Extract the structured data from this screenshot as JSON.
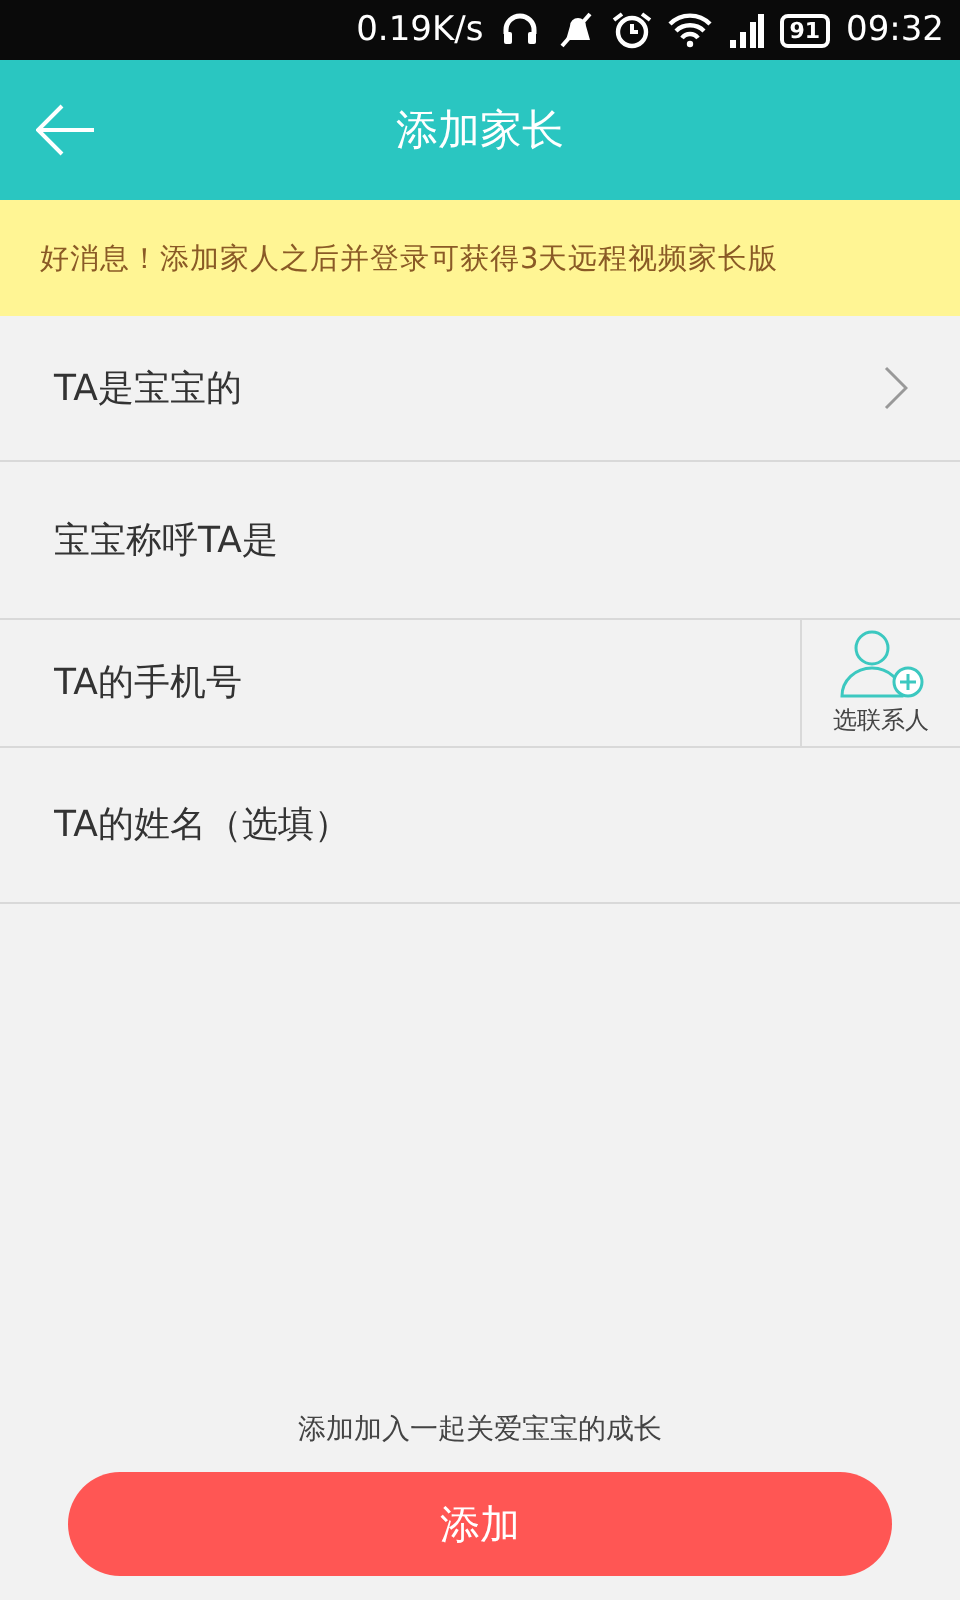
{
  "status_bar": {
    "speed": "0.19K/s",
    "battery": "91",
    "time": "09:32"
  },
  "header": {
    "title": "添加家长"
  },
  "notice": "好消息！添加家人之后并登录可获得3天远程视频家长版",
  "fields": [
    {
      "kind": "select",
      "placeholder": "TA是宝宝的"
    },
    {
      "kind": "input",
      "placeholder": "宝宝称呼TA是"
    },
    {
      "kind": "contact",
      "placeholder": "TA的手机号",
      "button": "选联系人"
    },
    {
      "kind": "input",
      "placeholder": "TA的姓名（选填）"
    }
  ],
  "hint": "添加加入一起关爱宝宝的成长",
  "submit": "添加"
}
